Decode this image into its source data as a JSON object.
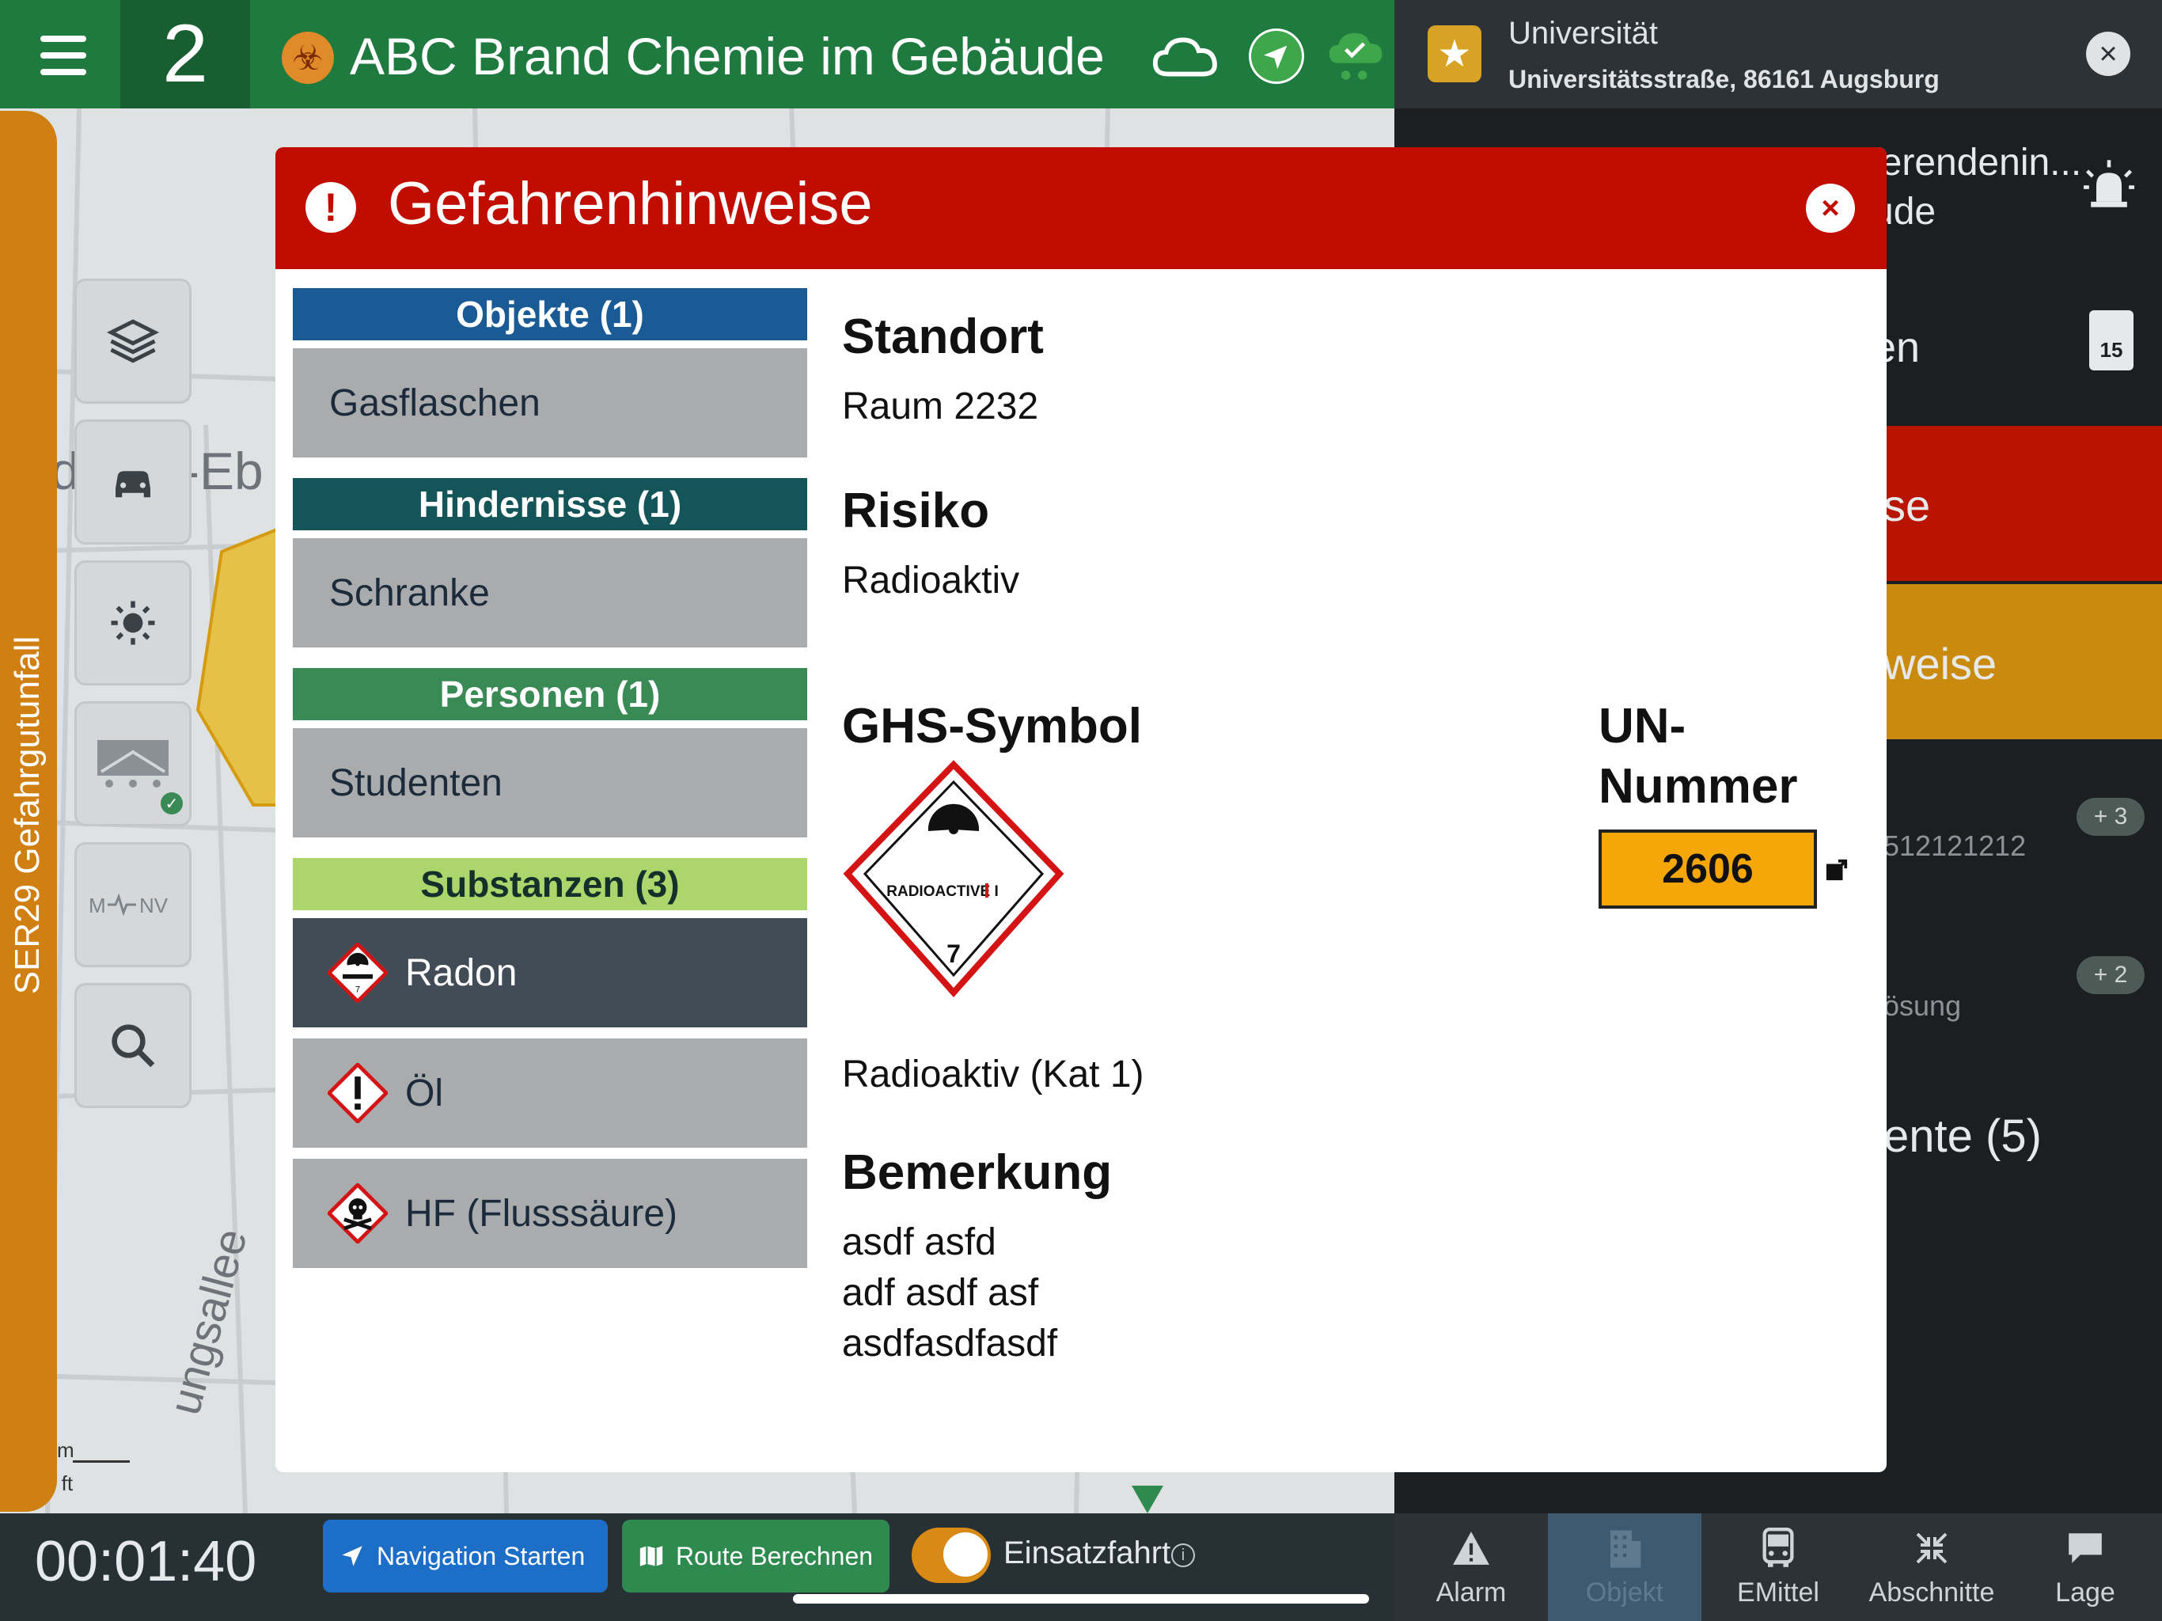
{
  "topbar": {
    "alarm_level": "2",
    "incident_title": "ABC Brand Chemie im Gebäude",
    "icons": [
      "menu-icon",
      "biohazard-icon",
      "cloud-icon",
      "navigation-icon",
      "sync-cloud-icon"
    ]
  },
  "object_panel": {
    "name": "Universität",
    "address": "Universitätsstraße, 86161 Augsburg",
    "partial_line1": "ierendenin...",
    "partial_line2": "ude",
    "partial_row2": "en",
    "doc_count": "15",
    "partial_red": "se",
    "partial_orange": "weise",
    "partial_number": "512121212",
    "badge1": "+ 3",
    "partial_sub": "ösung",
    "badge2": "+ 2",
    "partial_docs": "ente (5)"
  },
  "side_tools": {
    "vertical_label": "SER29 Gefahrgutunfall",
    "icons": [
      "layers-icon",
      "car-icon",
      "brightness-icon",
      "vehicle-icon",
      "mnv-icon",
      "search-icon"
    ],
    "mnv_label": "M ⁄ NV"
  },
  "map": {
    "label_fragment": "-Eb",
    "label_fragment2": "d",
    "street_fragment": "ungsallee",
    "scale_m": "m",
    "scale_ft": "0 ft"
  },
  "bottombar": {
    "timer": "00:01:40",
    "nav_start": "Navigation Starten",
    "route_calc": "Route Berechnen",
    "toggle_label": "Einsatzfahrt",
    "toggle_info": "i"
  },
  "tabs": [
    {
      "label": "Alarm",
      "icon": "warning-icon"
    },
    {
      "label": "Objekt",
      "icon": "building-icon",
      "active": true
    },
    {
      "label": "EMittel",
      "icon": "bus-icon"
    },
    {
      "label": "Abschnitte",
      "icon": "collapse-icon"
    },
    {
      "label": "Lage",
      "icon": "chat-icon"
    }
  ],
  "modal": {
    "title": "Gefahrenhinweise",
    "categories": [
      {
        "header": "Objekte (1)",
        "color": "#1a5b95",
        "items": [
          "Gasflaschen"
        ]
      },
      {
        "header": "Hindernisse (1)",
        "color": "#14555a",
        "items": [
          "Schranke"
        ]
      },
      {
        "header": "Personen (1)",
        "color": "#3a8a55",
        "items": [
          "Studenten"
        ]
      },
      {
        "header": "Substanzen (3)",
        "color": "#acd56b",
        "items": [
          "Radon",
          "Öl",
          "HF (Flusssäure)"
        ]
      }
    ],
    "selected_item": "Radon",
    "detail": {
      "standort_label": "Standort",
      "standort_value": "Raum 2232",
      "risiko_label": "Risiko",
      "risiko_value": "Radioaktiv",
      "ghs_label": "GHS-Symbol",
      "ghs_caption": "Radioaktiv (Kat 1)",
      "ghs_sign_text": "RADIOACTIVE I",
      "ghs_sign_class": "7",
      "un_label_1": "UN-",
      "un_label_2": "Nummer",
      "un_value": "2606",
      "bemerkung_label": "Bemerkung",
      "bemerkung_lines": [
        "asdf asfd",
        "adf asdf asf",
        "asdfasdfasdf"
      ]
    }
  },
  "colors": {
    "topbar": "#1f7a3f",
    "modal_header": "#c10d00",
    "orange_strip": "#d07f13",
    "un_box": "#f5a70a"
  }
}
